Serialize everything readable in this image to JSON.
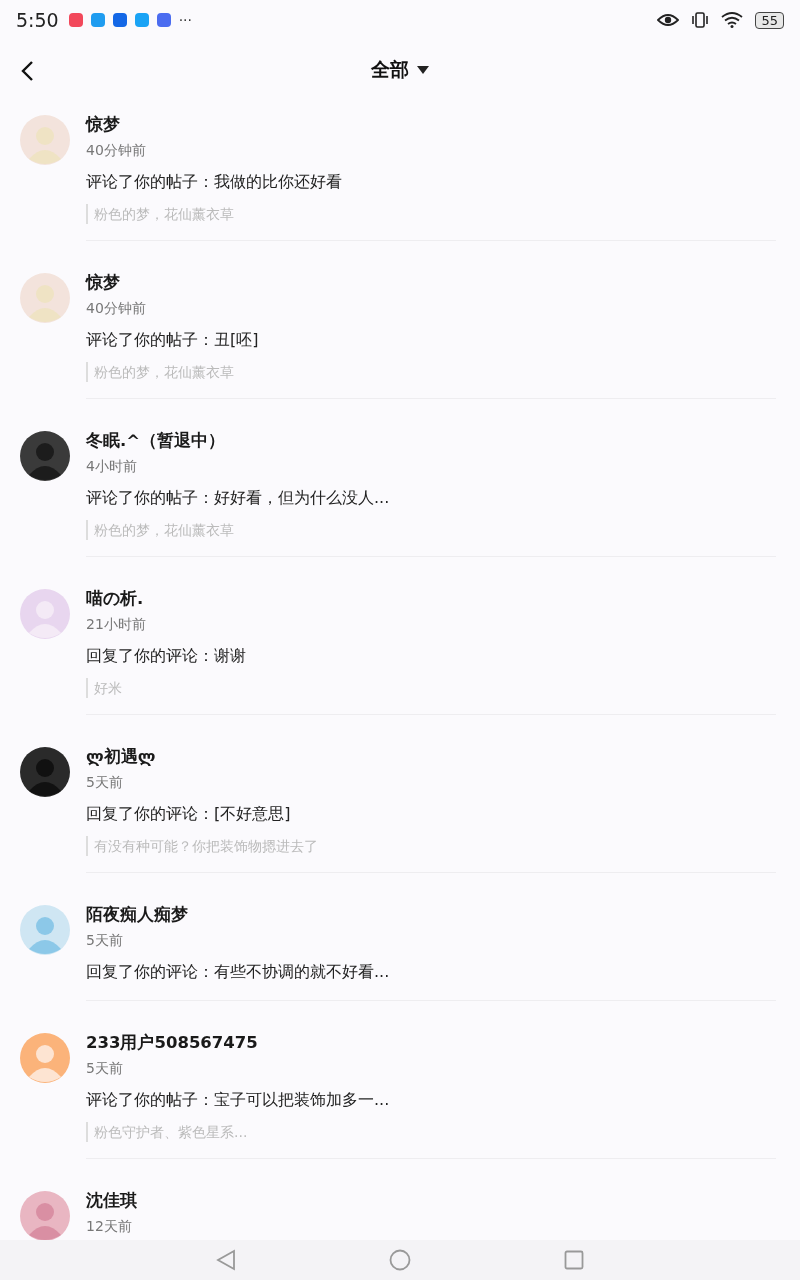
{
  "status_bar": {
    "time": "5:50",
    "more": "···",
    "battery": "55"
  },
  "header": {
    "title": "全部"
  },
  "notifications": [
    {
      "name": "惊梦",
      "time": "40分钟前",
      "action": "评论了你的帖子：我做的比你还好看",
      "quote": "粉色的梦，花仙薰衣草"
    },
    {
      "name": "惊梦",
      "time": "40分钟前",
      "action": "评论了你的帖子：丑[呸]",
      "quote": "粉色的梦，花仙薰衣草"
    },
    {
      "name": "冬眠.^（暂退中）",
      "time": "4小时前",
      "action": "评论了你的帖子：好好看，但为什么没人...",
      "quote": "粉色的梦，花仙薰衣草"
    },
    {
      "name": "喵の析.",
      "time": "21小时前",
      "action": "回复了你的评论：谢谢",
      "quote": "好米"
    },
    {
      "name": "ლ初遇ლ",
      "time": "5天前",
      "action": "回复了你的评论：[不好意思]",
      "quote": "有没有种可能？你把装饰物摁进去了"
    },
    {
      "name": "陌夜痴人痴梦",
      "time": "5天前",
      "action": "回复了你的评论：有些不协调的就不好看..."
    },
    {
      "name": "233用户508567475",
      "time": "5天前",
      "action": "评论了你的帖子：宝子可以把装饰加多一...",
      "quote": "粉色守护者、紫色星系..."
    },
    {
      "name": "沈佳琪",
      "time": "12天前"
    }
  ]
}
